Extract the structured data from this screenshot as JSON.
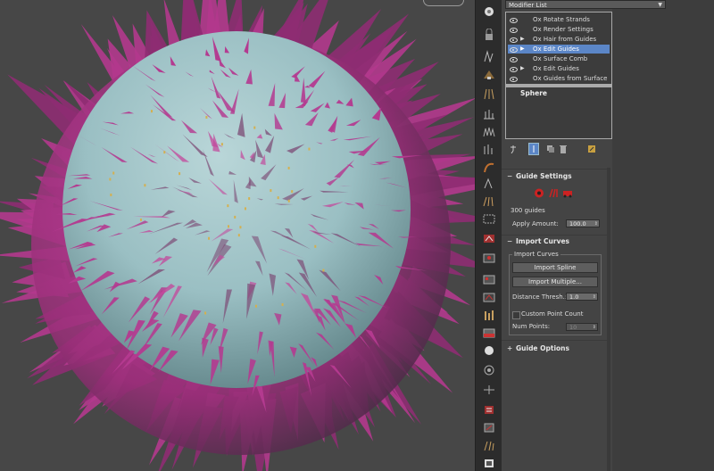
{
  "modifier_list": {
    "label": "Modifier List"
  },
  "stack": {
    "items": [
      {
        "label": "Ox Rotate Strands",
        "selected": false
      },
      {
        "label": "Ox Render Settings",
        "selected": false
      },
      {
        "label": "Ox Hair from Guides",
        "selected": false
      },
      {
        "label": "Ox Edit Guides",
        "selected": true
      },
      {
        "label": "Ox Surface Comb",
        "selected": false
      },
      {
        "label": "Ox Edit Guides",
        "selected": false
      },
      {
        "label": "Ox Guides from Surface",
        "selected": false
      }
    ],
    "base_object": "Sphere"
  },
  "guide_settings": {
    "title": "Guide Settings",
    "guide_count": "300 guides",
    "apply_amount_label": "Apply Amount:",
    "apply_amount_value": "100.0"
  },
  "import_curves": {
    "title": "Import Curves",
    "group_title": "Import Curves",
    "import_spline": "Import Spline",
    "import_multiple": "Import Multiple...",
    "distance_label": "Distance Thresh.:",
    "distance_value": "1.0",
    "custom_point_count": "Custom Point Count",
    "num_points_label": "Num Points:",
    "num_points_value": "10"
  },
  "guide_options": {
    "title": "Guide Options"
  },
  "colors": {
    "viewport_bg": "#474747",
    "sphere": "#9fc3c7",
    "hair": "#a8327f",
    "selection": "#5b86c7"
  }
}
